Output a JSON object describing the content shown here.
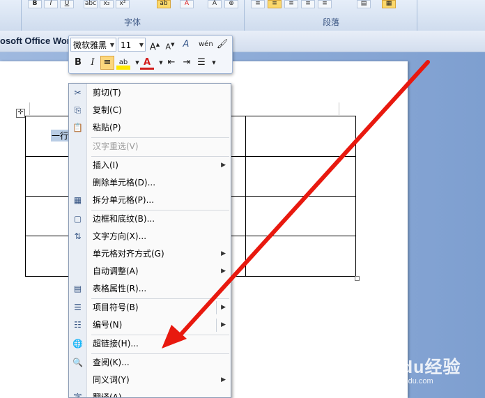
{
  "window": {
    "title": "osoft Office Wor"
  },
  "ribbon": {
    "font_group_label": "字体",
    "paragraph_group_label": "段落",
    "font_buttons": [
      "B",
      "I",
      "U",
      "abc",
      "x₂",
      "x²",
      "Aa",
      "ab",
      "A",
      "A"
    ],
    "para_buttons": [
      "≡",
      "≡",
      "≡",
      "≡",
      "≡"
    ]
  },
  "mini_toolbar": {
    "font_name": "微软雅黑",
    "font_size": "11",
    "grow_font": "A",
    "shrink_font": "A",
    "styles": "A",
    "phonetic": "wén",
    "bold": "B",
    "italic": "I",
    "highlight": "ab",
    "font_color": "A",
    "align_center": "≡",
    "outdent": "⇤",
    "indent": "⇥",
    "bullets": "☰"
  },
  "document": {
    "cell_text": "一行"
  },
  "context_menu": {
    "items": [
      {
        "label": "剪切(T)",
        "icon": "scissors-icon",
        "glyph": "✂"
      },
      {
        "label": "复制(C)",
        "icon": "copy-icon",
        "glyph": "⎘"
      },
      {
        "label": "粘贴(P)",
        "icon": "paste-icon",
        "glyph": "📋"
      },
      {
        "label": "汉字重选(V)",
        "disabled": true
      },
      {
        "label": "插入(I)",
        "submenu": true
      },
      {
        "label": "删除单元格(D)..."
      },
      {
        "label": "拆分单元格(P)...",
        "icon": "split-cells-icon",
        "glyph": "▦"
      },
      {
        "label": "边框和底纹(B)...",
        "icon": "borders-icon",
        "glyph": "▢"
      },
      {
        "label": "文字方向(X)...",
        "icon": "text-direction-icon",
        "glyph": "⇅"
      },
      {
        "label": "单元格对齐方式(G)",
        "submenu": true
      },
      {
        "label": "自动调整(A)",
        "submenu": true
      },
      {
        "label": "表格属性(R)...",
        "icon": "table-properties-icon",
        "glyph": "▤"
      },
      {
        "label": "项目符号(B)",
        "icon": "bullets-icon",
        "glyph": "☰",
        "submenu": true,
        "split": true
      },
      {
        "label": "编号(N)",
        "icon": "numbering-icon",
        "glyph": "☷",
        "submenu": true,
        "split": true
      },
      {
        "label": "超链接(H)...",
        "icon": "hyperlink-icon",
        "glyph": "🌐"
      },
      {
        "label": "查阅(K)...",
        "icon": "research-icon",
        "glyph": "🔍"
      },
      {
        "label": "同义词(Y)",
        "submenu": true
      },
      {
        "label": "翻译(A)",
        "icon": "translate-icon",
        "glyph": "字"
      }
    ]
  },
  "watermark": {
    "brand": "Baidu经验",
    "url": "jingyan.baidu.com"
  },
  "colors": {
    "ribbon": "#dbe6f4",
    "workspace": "#8aaad6",
    "arrow": "#e8190f",
    "highlight": "#fcd67c"
  }
}
